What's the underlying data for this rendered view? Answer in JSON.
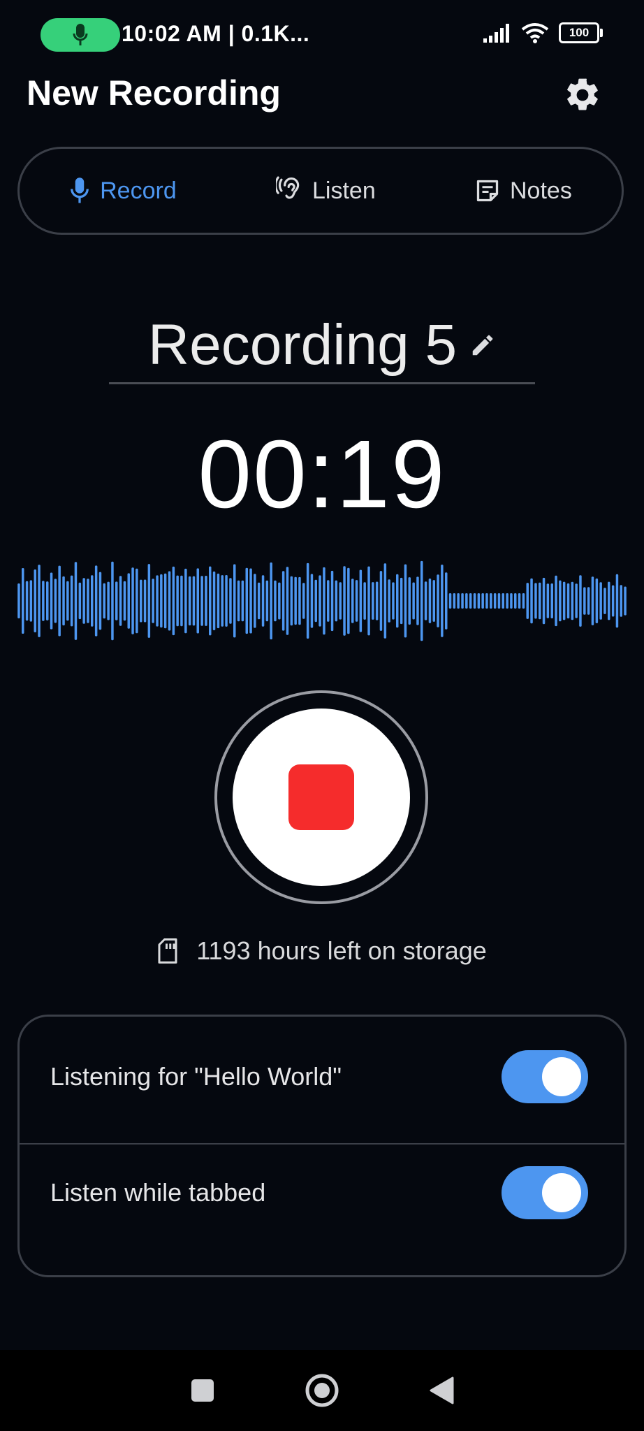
{
  "status_bar": {
    "time_text": "10:02 AM | 0.1K...",
    "battery": "100",
    "icons": [
      "mic-icon",
      "signal-icon",
      "wifi-icon",
      "battery-icon"
    ]
  },
  "header": {
    "title": "New Recording",
    "settings_icon": "gear-icon"
  },
  "tabs": [
    {
      "label": "Record",
      "icon": "mic-icon",
      "active": true
    },
    {
      "label": "Listen",
      "icon": "ear-icon",
      "active": false
    },
    {
      "label": "Notes",
      "icon": "notes-icon",
      "active": false
    }
  ],
  "recording": {
    "name": "Recording 5",
    "edit_icon": "pencil-icon",
    "timer": "00:19",
    "button_icon": "stop-icon"
  },
  "storage": {
    "icon": "sd-card-icon",
    "text": "1193 hours left on storage"
  },
  "settings": [
    {
      "label": "Listening for \"Hello World\"",
      "enabled": true
    },
    {
      "label": "Listen while tabbed",
      "enabled": true
    }
  ],
  "nav": [
    "recents-square-icon",
    "home-circle-icon",
    "back-triangle-icon"
  ],
  "colors": {
    "background": "#05080f",
    "accent": "#4d96f0",
    "record_red": "#f52c2c",
    "status_pill": "#36d07a",
    "border": "#3b3f48"
  }
}
